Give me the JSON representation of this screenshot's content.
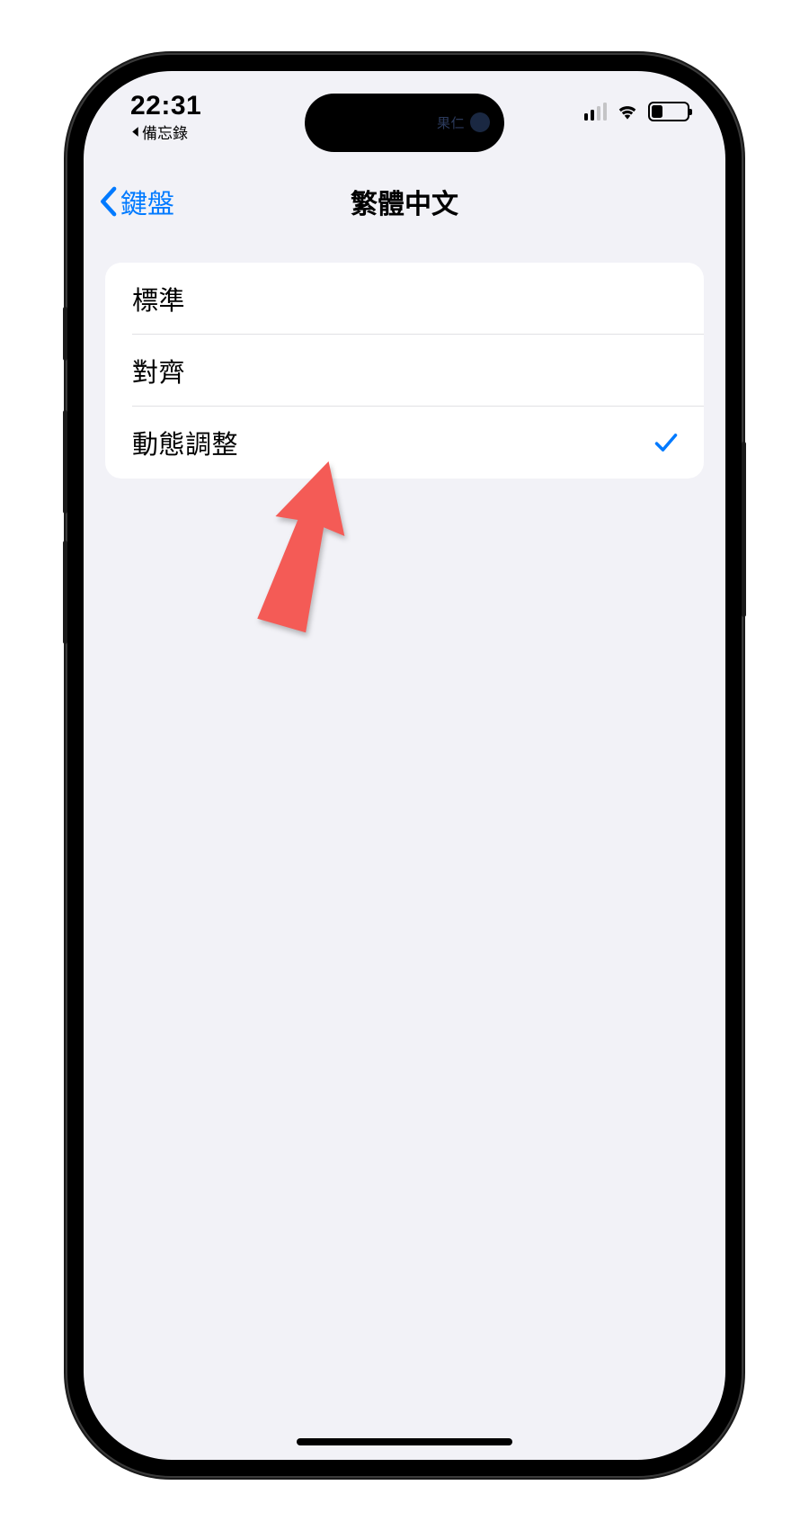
{
  "status": {
    "time": "22:31",
    "breadcrumb_app": "備忘錄",
    "island_text": "果仁"
  },
  "nav": {
    "back_label": "鍵盤",
    "title": "繁體中文"
  },
  "options": [
    {
      "label": "標準",
      "selected": false
    },
    {
      "label": "對齊",
      "selected": false
    },
    {
      "label": "動態調整",
      "selected": true
    }
  ],
  "colors": {
    "accent": "#007aff",
    "background": "#f2f2f7",
    "annotation": "#f45b56"
  }
}
